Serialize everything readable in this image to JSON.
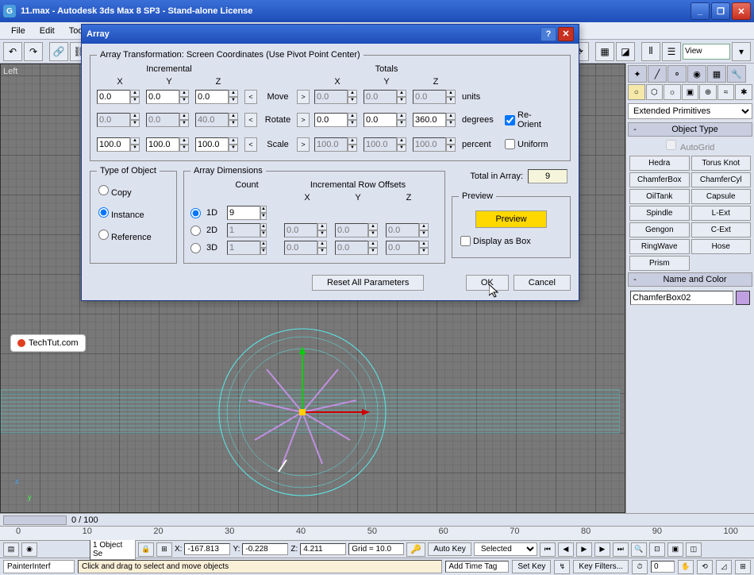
{
  "window": {
    "title": "11.max - Autodesk 3ds Max 8 SP3  - Stand-alone License"
  },
  "menu": {
    "file": "File",
    "edit": "Edit",
    "tools": "Tools"
  },
  "viewport": {
    "label": "Left"
  },
  "watermark": "TechTut.com",
  "dialog": {
    "title": "Array",
    "transform_legend": "Array Transformation: Screen Coordinates (Use Pivot Point Center)",
    "incremental": "Incremental",
    "totals": "Totals",
    "x": "X",
    "y": "Y",
    "z": "Z",
    "move": "Move",
    "rotate": "Rotate",
    "scale": "Scale",
    "units": "units",
    "degrees": "degrees",
    "percent": "percent",
    "reorient": "Re-Orient",
    "uniform": "Uniform",
    "move_ix": "0.0",
    "move_iy": "0.0",
    "move_iz": "0.0",
    "move_tx": "0.0",
    "move_ty": "0.0",
    "move_tz": "0.0",
    "rot_ix": "0.0",
    "rot_iy": "0.0",
    "rot_iz": "40.0",
    "rot_tx": "0.0",
    "rot_ty": "0.0",
    "rot_tz": "360.0",
    "scl_ix": "100.0",
    "scl_iy": "100.0",
    "scl_iz": "100.0",
    "scl_tx": "100.0",
    "scl_ty": "100.0",
    "scl_tz": "100.0",
    "type_legend": "Type of Object",
    "copy": "Copy",
    "instance": "Instance",
    "reference": "Reference",
    "dims_legend": "Array Dimensions",
    "count": "Count",
    "row_offsets": "Incremental Row Offsets",
    "d1": "1D",
    "d2": "2D",
    "d3": "3D",
    "c1": "9",
    "c2": "1",
    "c3": "1",
    "d2x": "0.0",
    "d2y": "0.0",
    "d2z": "0.0",
    "d3x": "0.0",
    "d3y": "0.0",
    "d3z": "0.0",
    "total_label": "Total in Array:",
    "total_val": "9",
    "preview_legend": "Preview",
    "preview_btn": "Preview",
    "display_box": "Display as Box",
    "reset": "Reset All Parameters",
    "ok": "OK",
    "cancel": "Cancel"
  },
  "panel": {
    "category": "Extended Primitives",
    "object_type": "Object Type",
    "autogrid": "AutoGrid",
    "buttons": [
      "Hedra",
      "Torus Knot",
      "ChamferBox",
      "ChamferCyl",
      "OilTank",
      "Capsule",
      "Spindle",
      "L-Ext",
      "Gengon",
      "C-Ext",
      "RingWave",
      "Hose",
      "Prism"
    ],
    "name_color": "Name and Color",
    "obj_name": "ChamferBox02"
  },
  "toolbar_view": "View",
  "timeline": {
    "label": "0 / 100"
  },
  "ruler": [
    "0",
    "10",
    "20",
    "30",
    "40",
    "50",
    "60",
    "70",
    "80",
    "90",
    "100"
  ],
  "status": {
    "sel": "1 Object Se",
    "x": "-167.813",
    "y": "-0.228",
    "z": "4.211",
    "grid": "Grid = 10.0",
    "autokey": "Auto Key",
    "setkey": "Set Key",
    "selected": "Selected",
    "keyfilters": "Key Filters...",
    "addtime": "Add Time Tag",
    "prompt": "Click and drag to select and move objects",
    "painter": "PainterInterf"
  }
}
